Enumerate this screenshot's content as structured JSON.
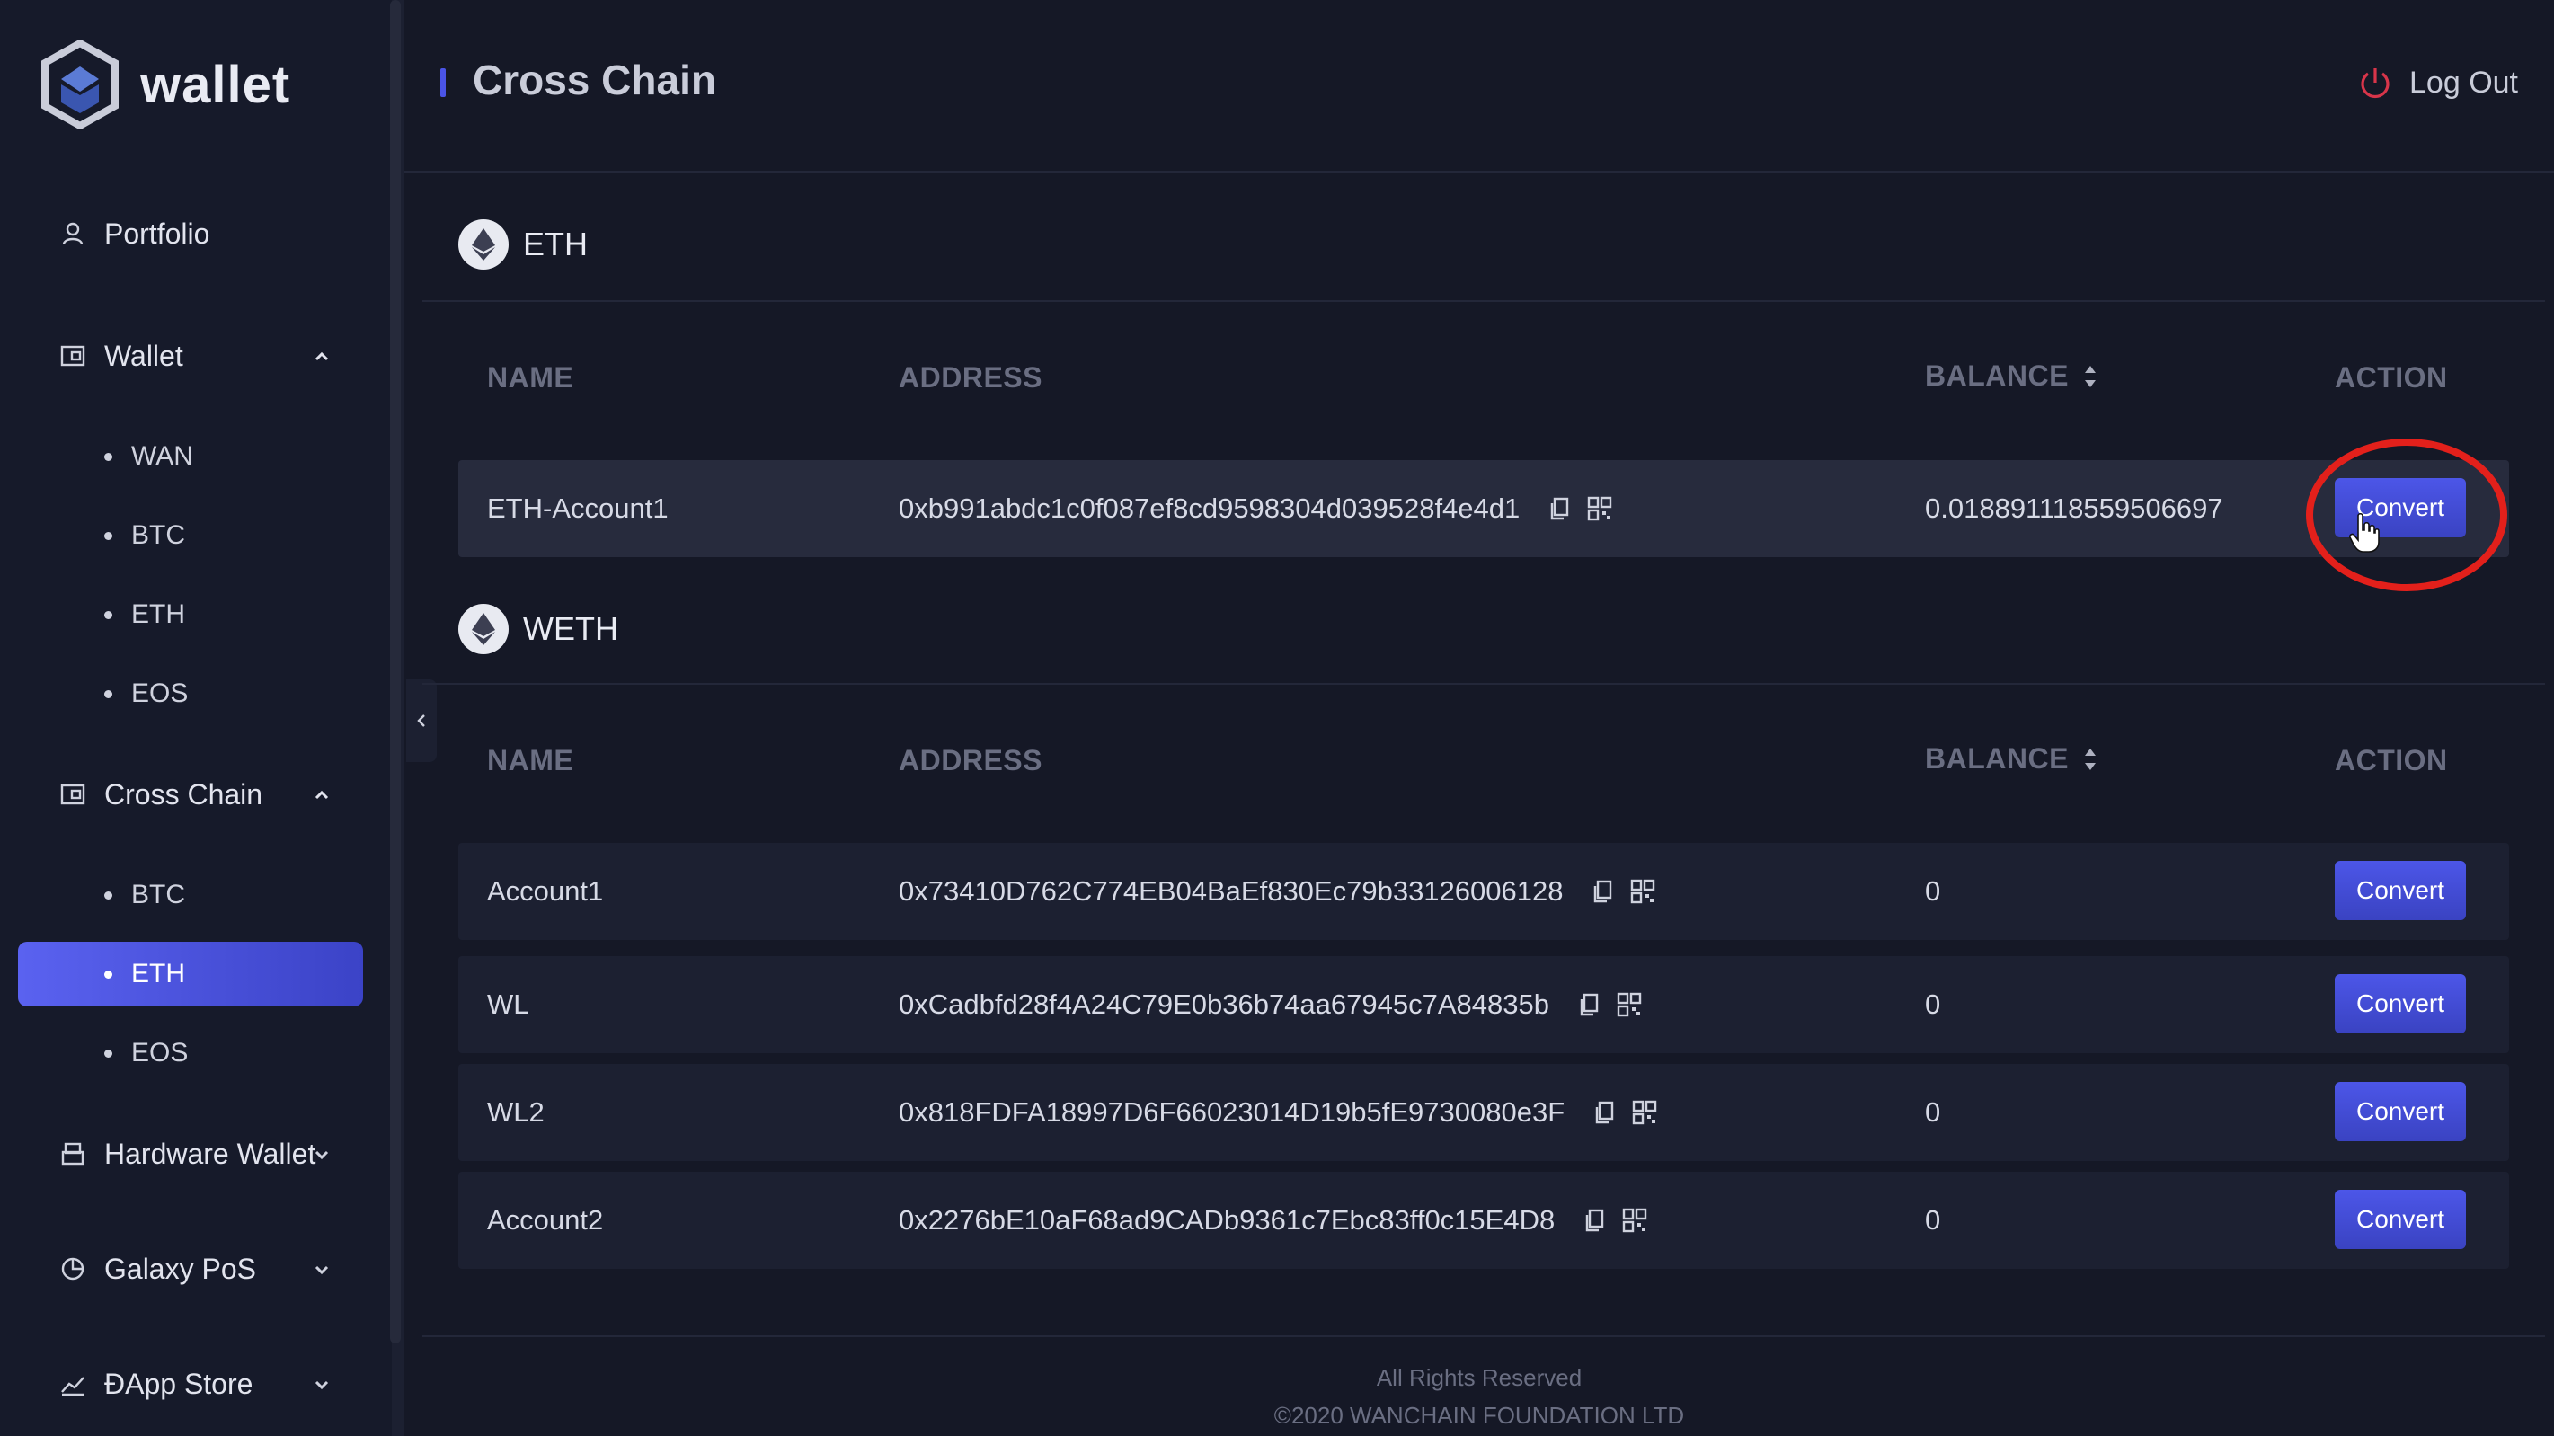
{
  "brand": {
    "name": "wallet"
  },
  "header": {
    "title": "Cross Chain",
    "logout_label": "Log Out"
  },
  "sidebar": {
    "items": [
      {
        "label": "Portfolio",
        "icon": "user-icon"
      },
      {
        "label": "Wallet",
        "icon": "wallet-icon",
        "expanded": true,
        "children": [
          "WAN",
          "BTC",
          "ETH",
          "EOS"
        ]
      },
      {
        "label": "Cross Chain",
        "icon": "wallet-icon",
        "expanded": true,
        "children": [
          "BTC",
          "ETH",
          "EOS"
        ],
        "active_child": "ETH"
      },
      {
        "label": "Hardware Wallet",
        "icon": "hardware-icon",
        "expanded": false
      },
      {
        "label": "Galaxy PoS",
        "icon": "pie-chart-icon",
        "expanded": false
      },
      {
        "label": "ĐApp Store",
        "icon": "line-chart-icon",
        "expanded": false
      }
    ]
  },
  "table_headers": {
    "name": "NAME",
    "address": "ADDRESS",
    "balance": "BALANCE",
    "action": "ACTION"
  },
  "sections": [
    {
      "title": "ETH",
      "icon": "ethereum-icon",
      "rows": [
        {
          "name": "ETH-Account1",
          "address": "0xb991abdc1c0f087ef8cd9598304d039528f4e4d1",
          "balance": "0.018891118559506697",
          "action": "Convert"
        }
      ]
    },
    {
      "title": "WETH",
      "icon": "ethereum-icon",
      "rows": [
        {
          "name": "Account1",
          "address": "0x73410D762C774EB04BaEf830Ec79b33126006128",
          "balance": "0",
          "action": "Convert"
        },
        {
          "name": "WL",
          "address": "0xCadbfd28f4A24C79E0b36b74aa67945c7A84835b",
          "balance": "0",
          "action": "Convert"
        },
        {
          "name": "WL2",
          "address": "0x818FDFA18997D6F66023014D19b5fE9730080e3F",
          "balance": "0",
          "action": "Convert"
        },
        {
          "name": "Account2",
          "address": "0x2276bE10aF68ad9CADb9361c7Ebc83ff0c15E4D8",
          "balance": "0",
          "action": "Convert"
        }
      ]
    }
  ],
  "footer": {
    "line1": "All Rights Reserved",
    "line2": "©2020 WANCHAIN FOUNDATION LTD"
  },
  "colors": {
    "accent": "#4c56e8",
    "annotation": "#e3201b",
    "logout_icon": "#d8354a"
  }
}
